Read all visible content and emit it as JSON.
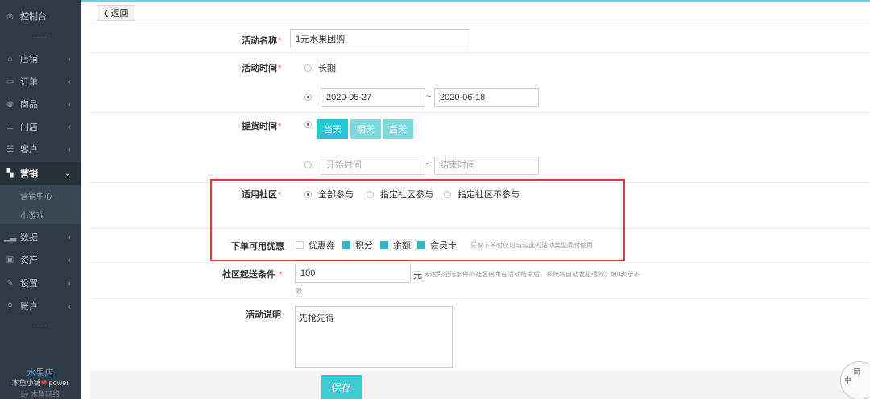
{
  "sidebar": {
    "console": "控制台",
    "items": [
      {
        "label": "店铺",
        "icon": "store-icon"
      },
      {
        "label": "订单",
        "icon": "order-icon"
      },
      {
        "label": "商品",
        "icon": "goods-icon"
      },
      {
        "label": "门店",
        "icon": "shop-icon"
      },
      {
        "label": "客户",
        "icon": "customer-icon"
      },
      {
        "label": "营销",
        "icon": "marketing-icon"
      },
      {
        "label": "数据",
        "icon": "chart-icon"
      },
      {
        "label": "资产",
        "icon": "asset-icon"
      },
      {
        "label": "设置",
        "icon": "wrench-icon"
      },
      {
        "label": "账户",
        "icon": "key-icon"
      }
    ],
    "sub_items": [
      "营销中心",
      "小游戏"
    ],
    "brand_name": "水果店",
    "brand_power_prefix": "木鱼小铺",
    "brand_power_suffix": "power",
    "brand_by": "by 木鱼网络",
    "dots": "……"
  },
  "header": {
    "back_label": "返回"
  },
  "form": {
    "name_label": "活动名称",
    "name_value": "1元水果团购",
    "time_label": "活动时间",
    "time_long_label": "长期",
    "start_date": "2020-05-27",
    "end_date": "2020-06-18",
    "tilde": "~",
    "pickup_label": "提货时间",
    "pickup_days": [
      "当天",
      "明天",
      "后天"
    ],
    "pickup_start_placeholder": "开始时间",
    "pickup_end_placeholder": "结束时间",
    "community_label": "适用社区",
    "community_options": [
      "全部参与",
      "指定社区参与",
      "指定社区不参与"
    ],
    "discount_label": "下单可用优惠",
    "discount_options": [
      {
        "label": "优惠券",
        "checked": false
      },
      {
        "label": "积分",
        "checked": true
      },
      {
        "label": "余额",
        "checked": true
      },
      {
        "label": "会员卡",
        "checked": true
      }
    ],
    "discount_hint": "买家下单时仅可与勾选的活动类型同时使用",
    "delivery_label": "社区起送条件",
    "delivery_value": "100",
    "delivery_unit": "元",
    "delivery_hint_1": "未达到起送条件的社区接龙在活动结束后，系统将自动发起退款；填0表示不",
    "delivery_hint_2": "限",
    "desc_label": "活动说明",
    "desc_value": "先抢先得",
    "required_mark": "*"
  },
  "footer": {
    "save_label": "保存"
  },
  "badge": {
    "chars": [
      "中",
      "简"
    ]
  },
  "colors": {
    "accent": "#25c6d7",
    "highlight_border": "#e53935",
    "sidebar_bg": "#2f3a45"
  }
}
